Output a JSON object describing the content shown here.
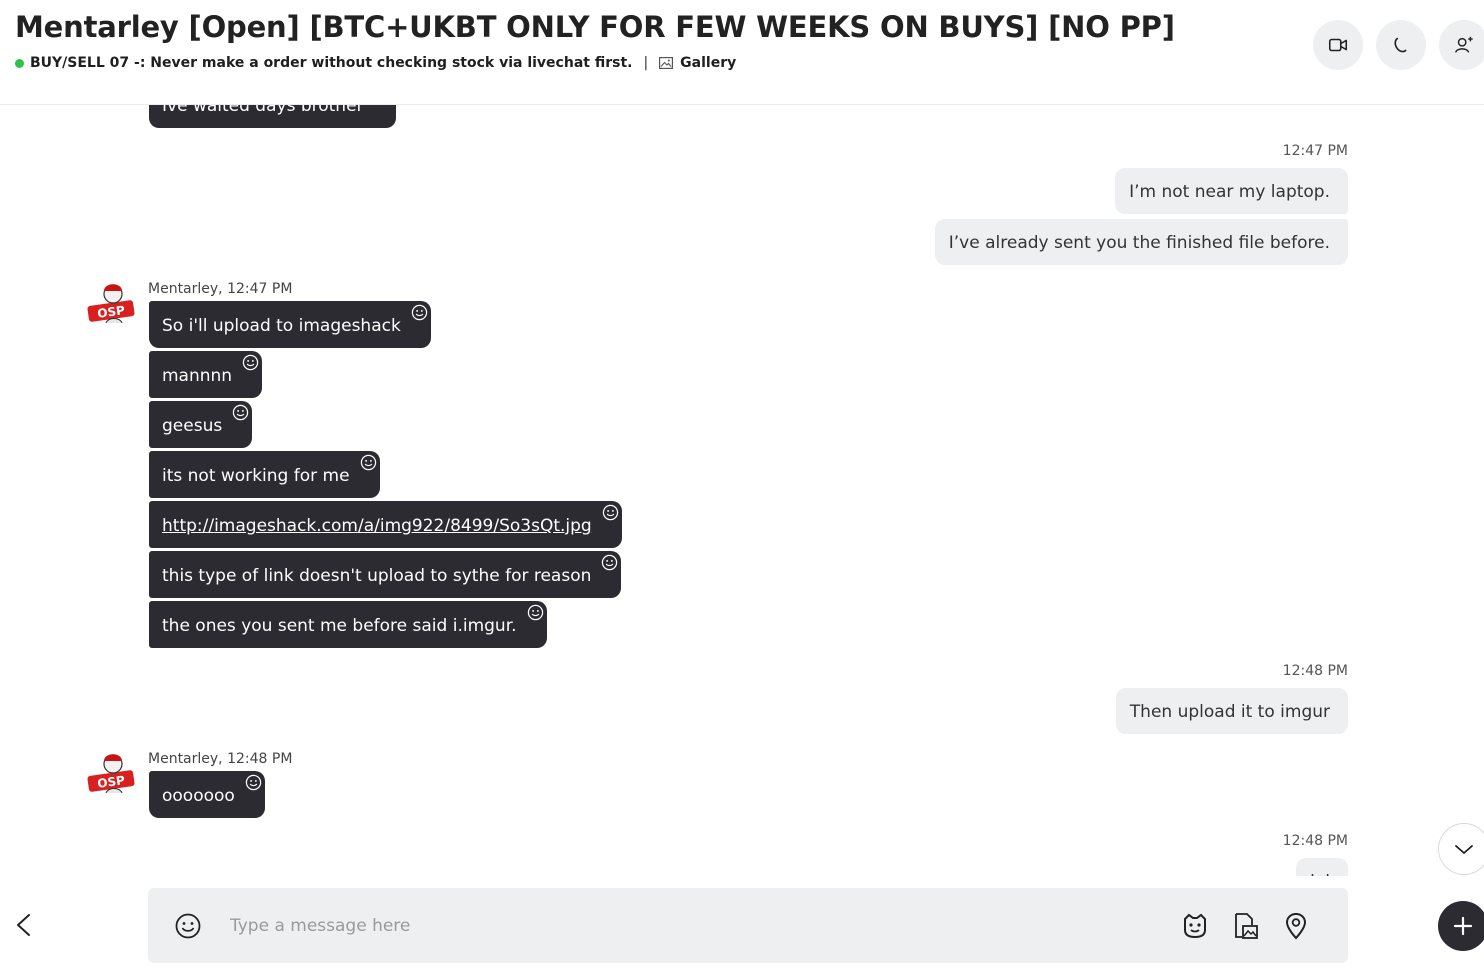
{
  "header": {
    "title": "Mentarley [Open] [BTC+UKBT ONLY FOR FEW WEEKS ON BUYS] [NO PP]",
    "status_text": "BUY/SELL 07 -: Never make a order without checking stock via livechat first.",
    "separator": "|",
    "gallery_label": "Gallery",
    "status_color": "#2dc24a",
    "buttons": [
      "video-call-icon",
      "voice-call-icon",
      "add-participant-icon"
    ]
  },
  "chat": {
    "partial_top_message": "Ive waited days brother",
    "groups": [
      {
        "timestamp": "12:47 PM",
        "outgoing": [
          "I’m not near my laptop.",
          "I’ve already sent you the finished file before."
        ]
      },
      {
        "sender": "Mentarley, 12:47 PM",
        "incoming": [
          "So i'll upload to imageshack",
          "mannnn",
          "geesus",
          "its not working for me",
          "http://imageshack.com/a/img922/8499/So3sQt.jpg",
          "this type of link doesn't upload to sythe for reason",
          "the ones you sent me before said i.imgur."
        ]
      },
      {
        "timestamp": "12:48 PM",
        "outgoing": [
          "Then upload it to imgur"
        ]
      },
      {
        "sender": "Mentarley, 12:48 PM",
        "incoming": [
          "ooooooo"
        ]
      },
      {
        "timestamp": "12:48 PM",
        "outgoing": [
          "lol"
        ]
      }
    ]
  },
  "composer": {
    "placeholder": "Type a message here",
    "icons": [
      "emoji-icon",
      "sticker-icon",
      "media-file-icon",
      "location-icon",
      "plus-icon"
    ]
  },
  "colors": {
    "incoming_bubble": "#2b2b31",
    "outgoing_bubble": "#eeeff1",
    "composer_bg": "#eeeff1"
  }
}
